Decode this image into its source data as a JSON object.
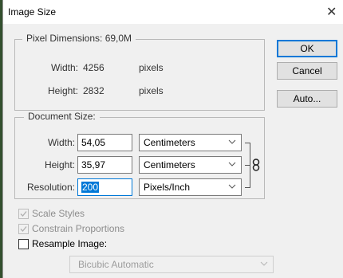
{
  "window": {
    "title": "Image Size",
    "close_glyph": "✕"
  },
  "pixel_dimensions": {
    "legend": "Pixel Dimensions:  69,0M",
    "width_label": "Width:",
    "width_value": "4256",
    "width_unit": "pixels",
    "height_label": "Height:",
    "height_value": "2832",
    "height_unit": "pixels"
  },
  "buttons": {
    "ok": "OK",
    "cancel": "Cancel",
    "auto": "Auto..."
  },
  "document_size": {
    "legend": "Document Size:",
    "width_label": "Width:",
    "width_value": "54,05",
    "width_unit": "Centimeters",
    "height_label": "Height:",
    "height_value": "35,97",
    "height_unit": "Centimeters",
    "resolution_label": "Resolution:",
    "resolution_value": "200",
    "resolution_unit": "Pixels/Inch"
  },
  "options": {
    "scale_styles": {
      "label": "Scale Styles",
      "checked": true,
      "enabled": false
    },
    "constrain_proportions": {
      "label": "Constrain Proportions",
      "checked": true,
      "enabled": false
    },
    "resample_image": {
      "label": "Resample Image:",
      "checked": false,
      "enabled": true
    },
    "resample_method": "Bicubic Automatic"
  },
  "icons": {
    "close": "close-icon",
    "link": "chain-link-icon",
    "dropdown": "chevron-down-icon",
    "check": "checkmark-icon"
  },
  "colors": {
    "focus_accent": "#0078d7",
    "dialog_bg": "#f0f0f0",
    "disabled_text": "#8d8d8d"
  }
}
